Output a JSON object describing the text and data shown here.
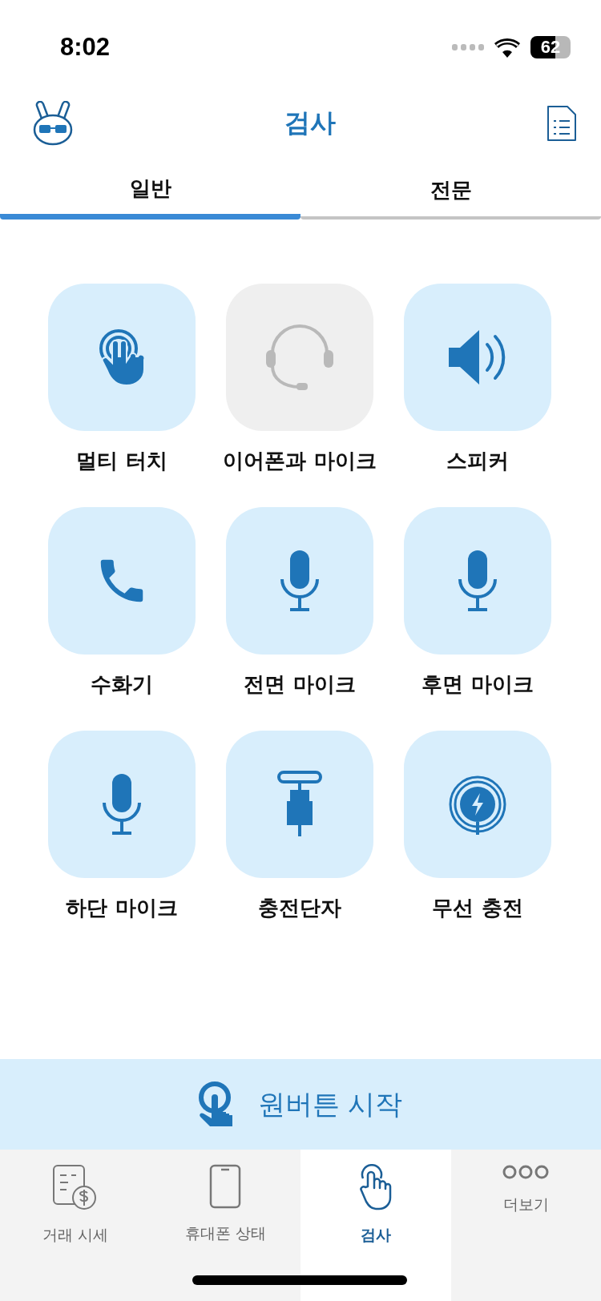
{
  "status_bar": {
    "time": "8:02",
    "battery": "62"
  },
  "header": {
    "title": "검사"
  },
  "tabs": [
    {
      "label": "일반",
      "selected": true
    },
    {
      "label": "전문",
      "selected": false
    }
  ],
  "tests": [
    {
      "label": "멀티 터치",
      "kind": "touch",
      "disabled": false
    },
    {
      "label": "이어폰과 마이크",
      "kind": "headset",
      "disabled": true
    },
    {
      "label": "스피커",
      "kind": "speaker",
      "disabled": false
    },
    {
      "label": "수화기",
      "kind": "phone",
      "disabled": false
    },
    {
      "label": "전면 마이크",
      "kind": "mic",
      "disabled": false
    },
    {
      "label": "후면 마이크",
      "kind": "mic",
      "disabled": false
    },
    {
      "label": "하단 마이크",
      "kind": "mic",
      "disabled": false
    },
    {
      "label": "충전단자",
      "kind": "port",
      "disabled": false
    },
    {
      "label": "무선 충전",
      "kind": "wireless",
      "disabled": false
    }
  ],
  "start_button": {
    "label": "원버튼 시작"
  },
  "bottom_nav": [
    {
      "label": "거래 시세",
      "kind": "price",
      "selected": false
    },
    {
      "label": "휴대폰 상태",
      "kind": "phone",
      "selected": false
    },
    {
      "label": "검사",
      "kind": "check",
      "selected": true
    },
    {
      "label": "더보기",
      "kind": "more",
      "selected": false
    }
  ]
}
